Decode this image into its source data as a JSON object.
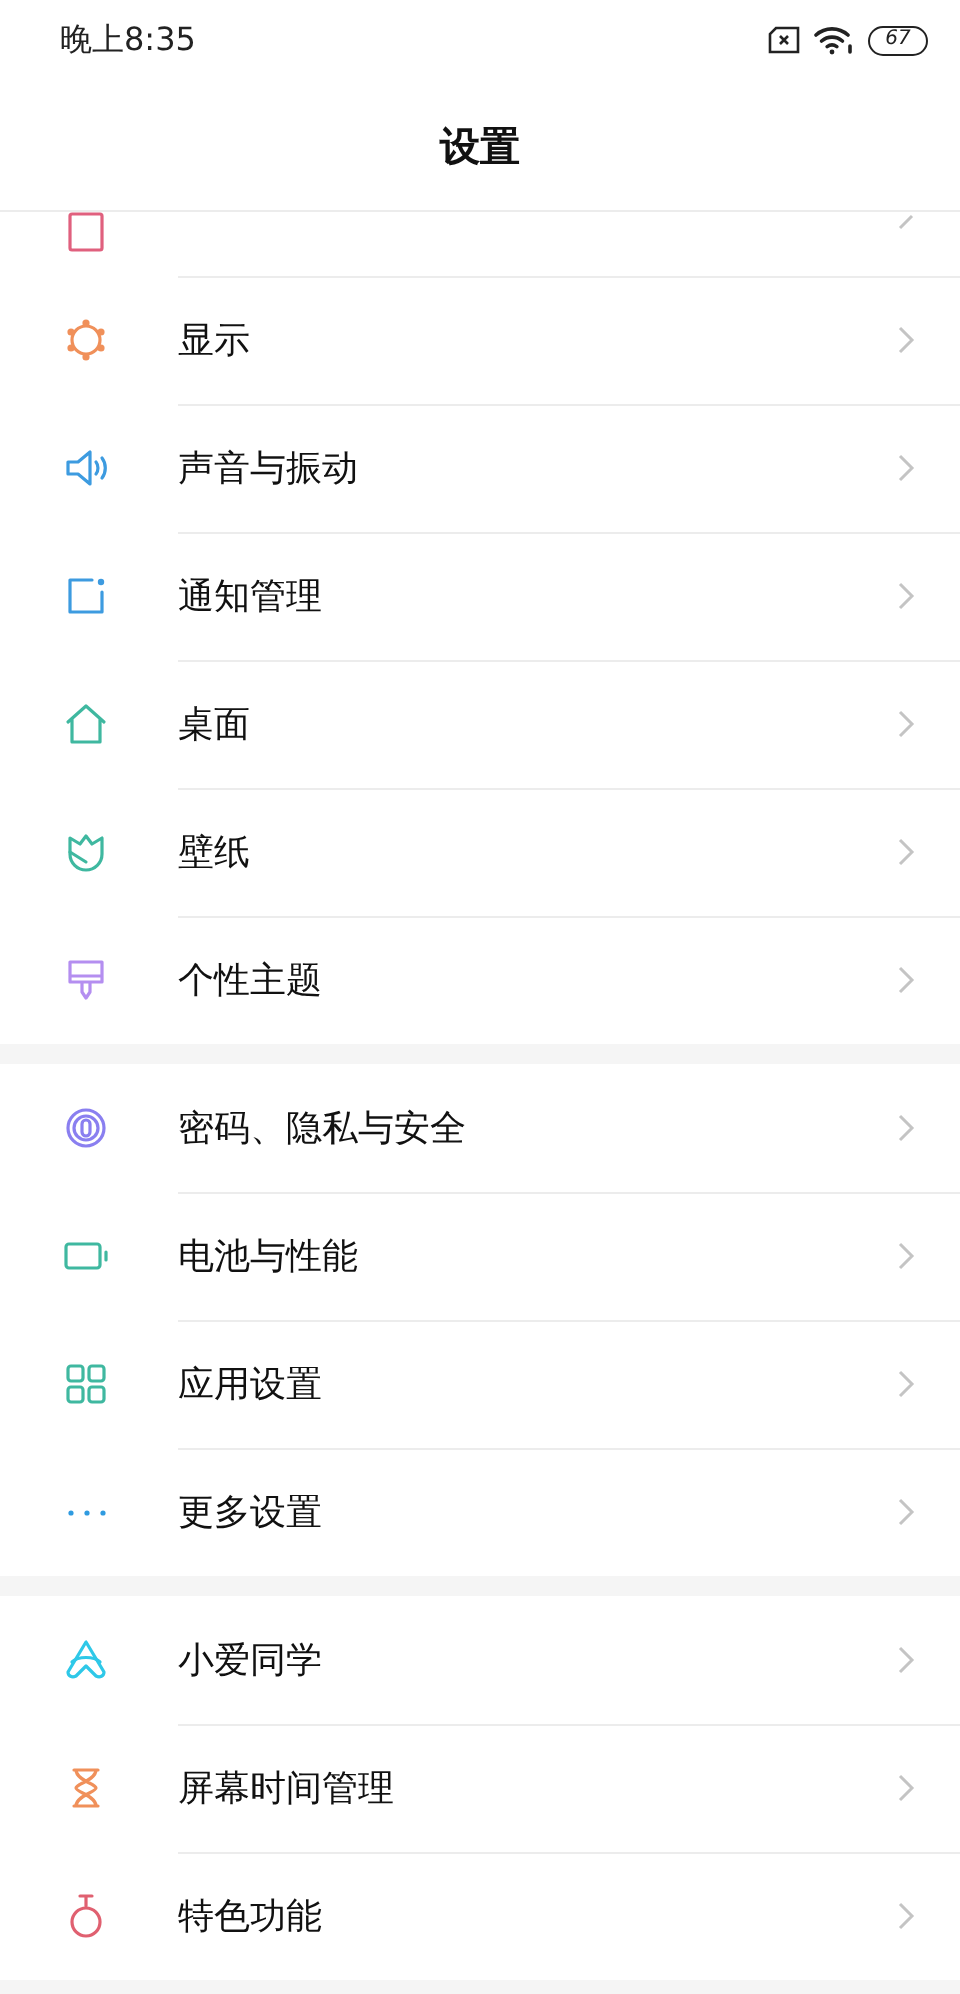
{
  "status_bar": {
    "time": "晚上8:35",
    "battery": "67"
  },
  "header": {
    "title": "设置"
  },
  "cut_row": {
    "kind": "lockscreen"
  },
  "groups": [
    {
      "items": [
        {
          "kind": "display",
          "label": "显示"
        },
        {
          "kind": "sound",
          "label": "声音与振动"
        },
        {
          "kind": "notification",
          "label": "通知管理"
        },
        {
          "kind": "home",
          "label": "桌面"
        },
        {
          "kind": "wallpaper",
          "label": "壁纸"
        },
        {
          "kind": "theme",
          "label": "个性主题"
        }
      ]
    },
    {
      "items": [
        {
          "kind": "privacy",
          "label": "密码、隐私与安全"
        },
        {
          "kind": "battery",
          "label": "电池与性能"
        },
        {
          "kind": "apps",
          "label": "应用设置"
        },
        {
          "kind": "more",
          "label": "更多设置"
        }
      ]
    },
    {
      "items": [
        {
          "kind": "assistant",
          "label": "小爱同学"
        },
        {
          "kind": "screentime",
          "label": "屏幕时间管理"
        },
        {
          "kind": "features",
          "label": "特色功能"
        }
      ]
    }
  ]
}
